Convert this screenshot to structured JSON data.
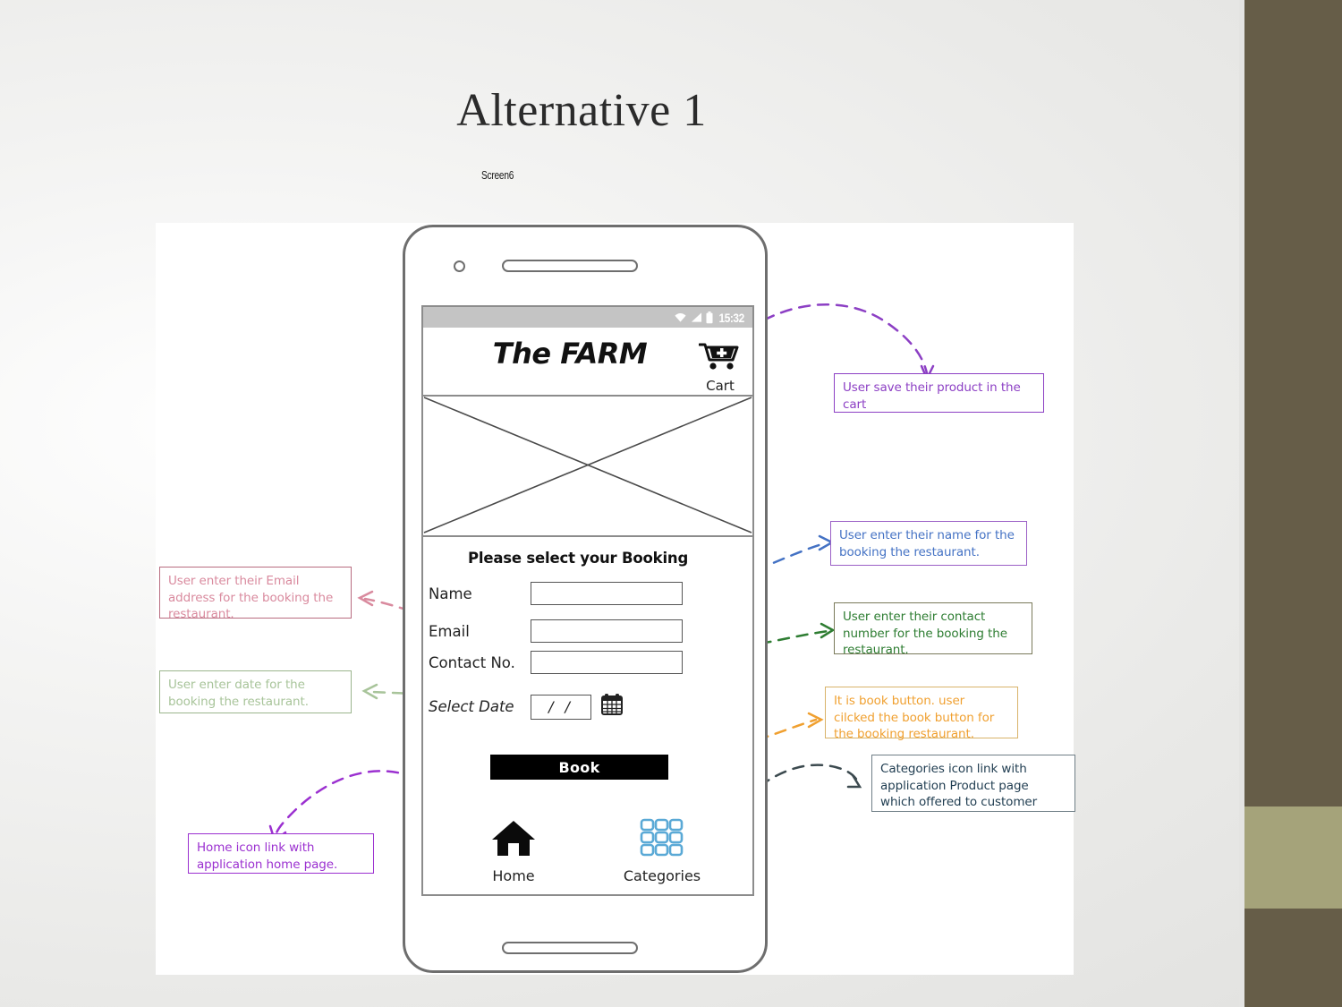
{
  "slide": {
    "title": "Alternative 1",
    "subtitle": "Screen6"
  },
  "theme": {
    "sidebar_dark": "#665d48",
    "sidebar_light": "#a5a37a",
    "background": "#eaeae8"
  },
  "phone": {
    "status_bar": {
      "time": "15:32",
      "icons": [
        "wifi-icon",
        "signal-icon",
        "battery-icon"
      ]
    },
    "header": {
      "brand": "The FARM",
      "cart_label": "Cart",
      "cart_icon": "shopping-cart-plus-icon"
    },
    "image_placeholder": {
      "icon": "crossed-box-placeholder"
    },
    "form": {
      "heading": "Please select your Booking",
      "fields": [
        {
          "label": "Name",
          "value": "",
          "placeholder": ""
        },
        {
          "label": "Email",
          "value": "",
          "placeholder": ""
        },
        {
          "label": "Contact No.",
          "value": "",
          "placeholder": ""
        }
      ],
      "date_field": {
        "label": "Select Date",
        "value": "/ /",
        "icon": "calendar-icon"
      },
      "submit_label": "Book"
    },
    "navbar": [
      {
        "label": "Home",
        "icon": "home-icon"
      },
      {
        "label": "Categories",
        "icon": "grid-categories-icon"
      }
    ]
  },
  "annotations": [
    {
      "id": "cart-note",
      "text": "User save their product in the cart",
      "color": "#8c3fc4",
      "border": "#8c3fc4"
    },
    {
      "id": "name-note",
      "text": "User enter their name for the booking the restaurant.",
      "color": "#4472c4",
      "border": "#9b60c6"
    },
    {
      "id": "contact-note",
      "text": "User enter their contact number for the booking the restaurant.",
      "color": "#2e7d32",
      "border": "#7a7a5a"
    },
    {
      "id": "book-note",
      "text": "It is book button. user cilcked the book button for the booking restaurant.",
      "color": "#f0a030",
      "border": "#d9b36a"
    },
    {
      "id": "categories-note",
      "text": "Categories icon link with application Product page which offered to customer",
      "color": "#1f3c50",
      "border": "#6f7e86"
    },
    {
      "id": "email-note",
      "text": "User enter their Email address for the booking the restaurant.",
      "color": "#d98a9e",
      "border": "#b86c80"
    },
    {
      "id": "date-note",
      "text": "User enter date for the booking the restaurant.",
      "color": "#a8c49a",
      "border": "#9bb58d"
    },
    {
      "id": "home-note",
      "text": "Home icon link with application home page.",
      "color": "#9b30d0",
      "border": "#9b30d0"
    }
  ]
}
